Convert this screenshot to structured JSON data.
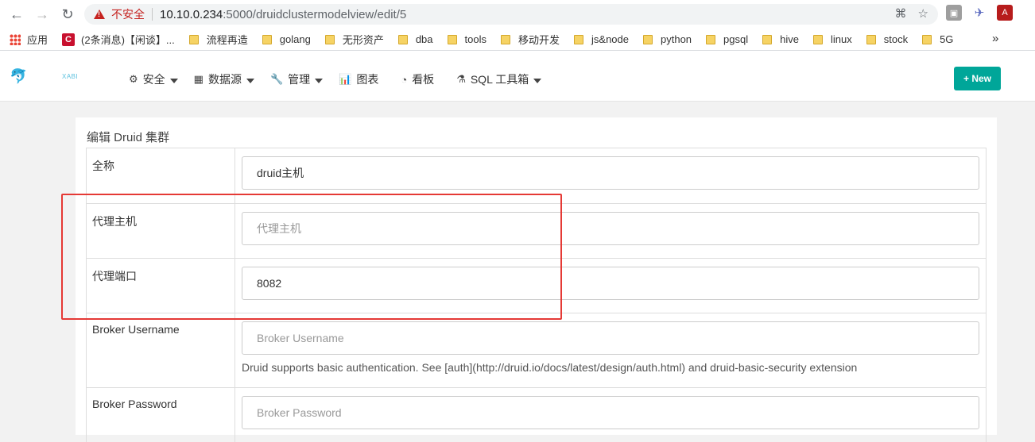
{
  "browser": {
    "insecure_label": "不安全",
    "url_host": "10.10.0.234",
    "url_rest": ":5000/druidclustermodelview/edit/5",
    "back_icon": "arrow-left-icon",
    "forward_icon": "arrow-right-icon",
    "reload_icon": "reload-icon"
  },
  "bookmarks": {
    "apps_label": "应用",
    "items": [
      "(2条消息)【闲谈】...",
      "流程再造",
      "golang",
      "无形资产",
      "dba",
      "tools",
      "移动开发",
      "js&node",
      "python",
      "pgsql",
      "hive",
      "linux",
      "stock",
      "5G"
    ],
    "more": "»"
  },
  "navbar": {
    "brand": "XABI",
    "menu": [
      {
        "label": "安全",
        "icon": "cogs-icon",
        "glyph": "⚙"
      },
      {
        "label": "数据源",
        "icon": "table-icon",
        "glyph": "▦"
      },
      {
        "label": "管理",
        "icon": "wrench-icon",
        "glyph": "🔧"
      },
      {
        "label": "图表",
        "icon": "bar-chart-icon",
        "glyph": "📊"
      },
      {
        "label": "看板",
        "icon": "dashboard-icon",
        "glyph": "◔"
      },
      {
        "label": "SQL 工具箱",
        "icon": "flask-icon",
        "glyph": "⚗"
      }
    ],
    "new_button": "+ New"
  },
  "form": {
    "title": "编辑 Druid 集群",
    "rows": [
      {
        "label": "全称",
        "value": "druid主机",
        "placeholder": ""
      },
      {
        "label": "代理主机",
        "value": "",
        "placeholder": "代理主机"
      },
      {
        "label": "代理端口",
        "value": "8082",
        "placeholder": ""
      },
      {
        "label": "Broker Username",
        "value": "",
        "placeholder": "Broker Username",
        "help": "Druid supports basic authentication. See [auth](http://druid.io/docs/latest/design/auth.html) and druid-basic-security extension"
      },
      {
        "label": "Broker Password",
        "value": "",
        "placeholder": "Broker Password"
      }
    ]
  },
  "colors": {
    "accent": "#00a699",
    "highlight": "#e53935",
    "insecure": "#c5221f"
  }
}
